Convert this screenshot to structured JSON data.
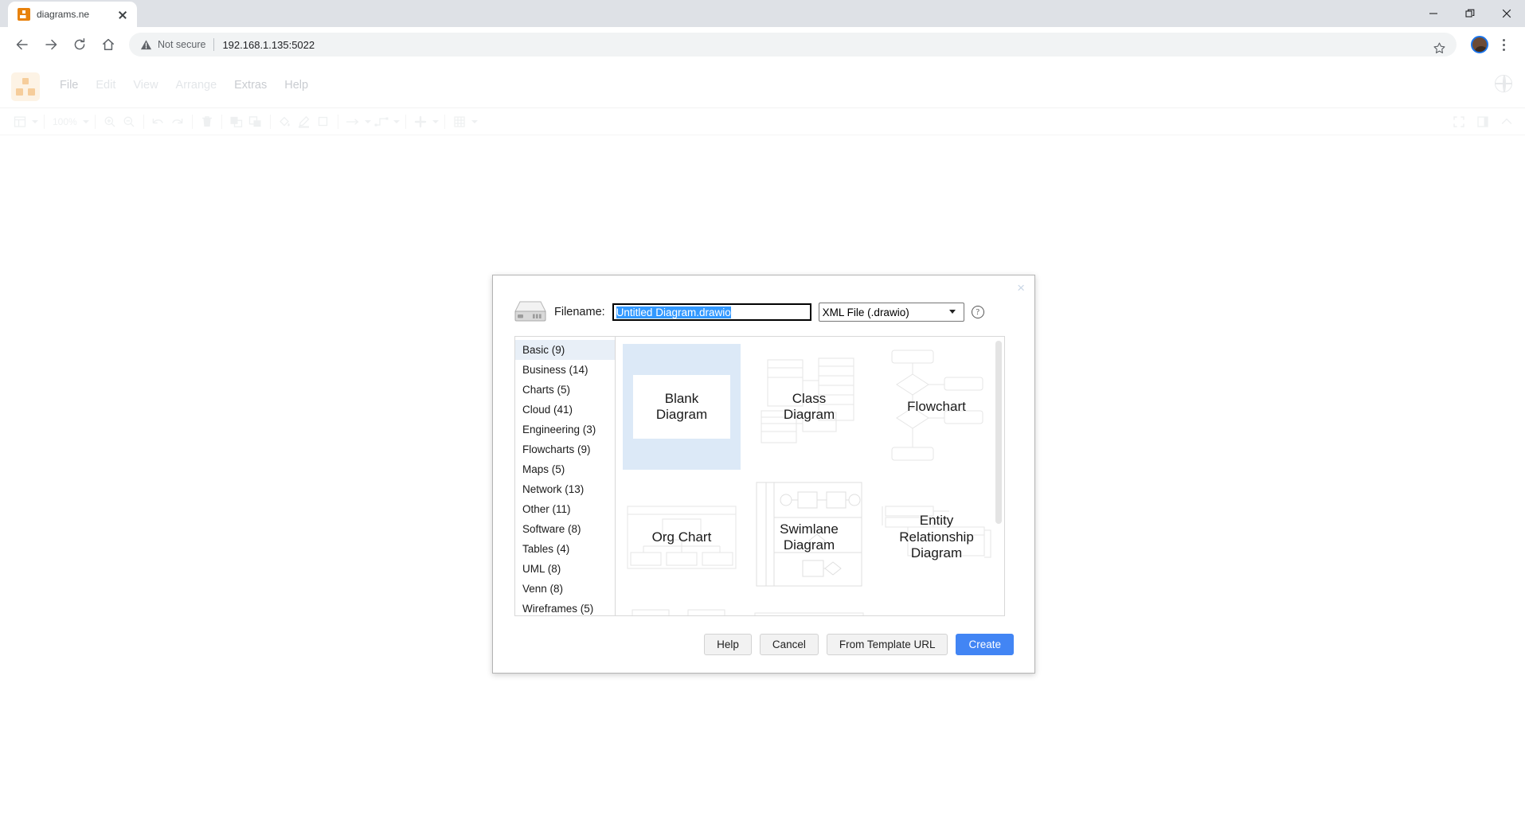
{
  "browser": {
    "tab": {
      "title": "diagrams.ne",
      "favicon": "drawio-favicon",
      "close_icon": "close-icon"
    },
    "window_controls": {
      "minimize": "minimize-icon",
      "restore": "restore-icon",
      "close": "close-icon"
    },
    "nav": {
      "back": "back-arrow-icon",
      "forward": "forward-arrow-icon",
      "reload": "reload-icon",
      "home": "home-icon"
    },
    "omnibox": {
      "security_icon": "warning-triangle-icon",
      "security_text": "Not secure",
      "url": "192.168.1.135:5022",
      "bookmark_icon": "star-icon"
    },
    "profile_icon": "avatar-icon",
    "menu_icon": "three-dot-menu-icon"
  },
  "app": {
    "logo": "drawio-logo",
    "globe_icon": "globe-icon",
    "menus": [
      {
        "label": "File",
        "dimmed": false
      },
      {
        "label": "Edit",
        "dimmed": true
      },
      {
        "label": "View",
        "dimmed": true
      },
      {
        "label": "Arrange",
        "dimmed": true
      },
      {
        "label": "Extras",
        "dimmed": false
      },
      {
        "label": "Help",
        "dimmed": false
      }
    ],
    "toolbar": {
      "zoom_level": "100%",
      "items": [
        "view-layout-icon",
        "zoom-in-icon",
        "zoom-out-icon",
        "undo-icon",
        "redo-icon",
        "delete-icon",
        "to-front-icon",
        "to-back-icon",
        "fill-color-icon",
        "line-color-icon",
        "shadow-icon",
        "connection-arrow-icon",
        "waypoints-icon",
        "insert-icon",
        "table-icon"
      ],
      "right_items": [
        "fullscreen-icon",
        "format-panel-icon",
        "collapse-icon"
      ]
    }
  },
  "dialog": {
    "close_label": "×",
    "drive_icon": "hard-drive-icon",
    "filename_label": "Filename:",
    "filename_value": "Untitled Diagram.drawio",
    "filename_placeholder": "Untitled Diagram.drawio",
    "filetype_selected": "XML File (.drawio)",
    "filetype_options": [
      "XML File (.drawio)"
    ],
    "help_icon": "question-mark-icon",
    "categories": [
      {
        "label": "Basic (9)",
        "selected": true
      },
      {
        "label": "Business (14)",
        "selected": false
      },
      {
        "label": "Charts (5)",
        "selected": false
      },
      {
        "label": "Cloud (41)",
        "selected": false
      },
      {
        "label": "Engineering (3)",
        "selected": false
      },
      {
        "label": "Flowcharts (9)",
        "selected": false
      },
      {
        "label": "Maps (5)",
        "selected": false
      },
      {
        "label": "Network (13)",
        "selected": false
      },
      {
        "label": "Other (11)",
        "selected": false
      },
      {
        "label": "Software (8)",
        "selected": false
      },
      {
        "label": "Tables (4)",
        "selected": false
      },
      {
        "label": "UML (8)",
        "selected": false
      },
      {
        "label": "Venn (8)",
        "selected": false
      },
      {
        "label": "Wireframes (5)",
        "selected": false
      }
    ],
    "templates": [
      {
        "label": "Blank\nDiagram",
        "art": "blank",
        "selected": true
      },
      {
        "label": "Class\nDiagram",
        "art": "class",
        "selected": false
      },
      {
        "label": "Flowchart",
        "art": "flow",
        "selected": false
      },
      {
        "label": "Org Chart",
        "art": "org",
        "selected": false
      },
      {
        "label": "Swimlane\nDiagram",
        "art": "swimlane",
        "selected": false
      },
      {
        "label": "Entity\nRelationship\nDiagram",
        "art": "erd",
        "selected": false
      },
      {
        "label": "",
        "art": "sequence",
        "selected": false
      },
      {
        "label": "",
        "art": "kanban",
        "selected": false
      },
      {
        "label": "",
        "art": "misc",
        "selected": false
      }
    ],
    "buttons": {
      "help": "Help",
      "cancel": "Cancel",
      "from_template_url": "From Template URL",
      "create": "Create"
    }
  },
  "colors": {
    "accent_blue": "#4285f4",
    "selection_blue": "#3399ff",
    "selected_row": "#e8eff7",
    "selected_tile": "#dce9f7",
    "favicon_orange": "#e8820c",
    "chrome_bg": "#dee1e6"
  }
}
